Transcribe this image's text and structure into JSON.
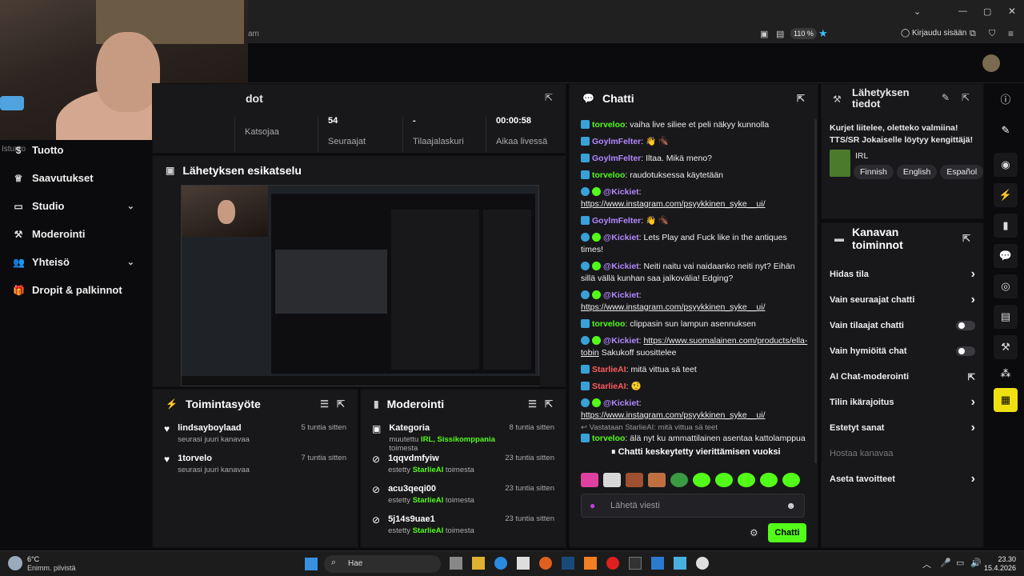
{
  "browser": {
    "zoom": "110 %",
    "login": "Kirjaudu sisään",
    "url_fragment": "am"
  },
  "sidebar": {
    "items": [
      {
        "label": "Tuotto",
        "icon": "dollar-icon"
      },
      {
        "label": "Saavutukset",
        "icon": "trophy-icon"
      },
      {
        "label": "Studio",
        "icon": "monitor-icon"
      },
      {
        "label": "Moderointi",
        "icon": "wrench-icon"
      },
      {
        "label": "Yhteisö",
        "icon": "users-icon"
      },
      {
        "label": "Dropit & palkinnot",
        "icon": "gift-icon"
      }
    ],
    "partial_label": "Istunto"
  },
  "stats": {
    "title_partial": "dot",
    "items": [
      {
        "value": "",
        "label": "Katsojaa"
      },
      {
        "value": "54",
        "label": "Seuraajat"
      },
      {
        "value": "-",
        "label": "Tilaajalaskuri"
      },
      {
        "value": "00:00:58",
        "label": "Aikaa livessä"
      }
    ]
  },
  "preview": {
    "title": "Lähetyksen esikatselu"
  },
  "activity": {
    "title": "Toimintasyöte",
    "rows": [
      {
        "name": "lindsayboylaad",
        "sub": "seurasi juuri kanavaa",
        "time": "5 tuntia sitten"
      },
      {
        "name": "1torvelo",
        "sub": "seurasi juuri kanavaa",
        "time": "7 tuntia sitten"
      }
    ]
  },
  "moderation": {
    "title": "Moderointi",
    "rows": [
      {
        "name": "Kategoria",
        "sub_pre": "muutettu",
        "sub_hl": "IRL, Sissikomppania",
        "sub_post": "toimesta",
        "time": "8 tuntia sitten"
      },
      {
        "name": "1qqvdmfyiw",
        "sub_pre": "estetty",
        "sub_hl": "StarlieAI",
        "sub_post": "toimesta",
        "time": "23 tuntia sitten"
      },
      {
        "name": "acu3qeqi00",
        "sub_pre": "estetty",
        "sub_hl": "StarlieAI",
        "sub_post": "toimesta",
        "time": "23 tuntia sitten"
      },
      {
        "name": "5j14s9uae1",
        "sub_pre": "estetty",
        "sub_hl": "StarlieAI",
        "sub_post": "toimesta",
        "time": "23 tuntia sitten"
      }
    ]
  },
  "chat": {
    "title": "Chatti",
    "messages": [
      {
        "user": "torveloo",
        "color": "#53fc18",
        "badge": "kick",
        "text": "vaiha live siliee et peli näkyy kunnolla"
      },
      {
        "user": "GoylmFelter",
        "color": "#b388ff",
        "badge": "kick",
        "text": "👋 🪳"
      },
      {
        "user": "GoylmFelter",
        "color": "#b388ff",
        "badge": "kick",
        "text": "Iltaa. Mikä meno?"
      },
      {
        "user": "torveloo",
        "color": "#53fc18",
        "badge": "kick",
        "text": "raudotuksessa käytetään"
      },
      {
        "user": "@Kickiet",
        "color": "#b388ff",
        "badge": "bot",
        "link": "https://www.instagram.com/psyykkinen_syke__ui/"
      },
      {
        "user": "GoylmFelter",
        "color": "#b388ff",
        "badge": "kick",
        "text": "👋 🪳"
      },
      {
        "user": "@Kickiet",
        "color": "#b388ff",
        "badge": "bot",
        "text": "Lets Play and Fuck like in the antiques times!"
      },
      {
        "user": "@Kickiet",
        "color": "#b388ff",
        "badge": "bot",
        "text": "Neiti naitu vai naidaanko neiti nyt? Eihän sillä vällä kunhan saa jalkovälia! Edging?"
      },
      {
        "user": "@Kickiet",
        "color": "#b388ff",
        "badge": "bot",
        "link": "https://www.instagram.com/psyykkinen_syke__ui/"
      },
      {
        "user": "torveloo",
        "color": "#53fc18",
        "badge": "kick",
        "text": "clippasin sun lampun asennuksen"
      },
      {
        "user": "@Kickiet",
        "color": "#b388ff",
        "badge": "bot",
        "link": "https://www.suomalainen.com/products/ella-tobin",
        "text": "Sakukoff suosittelee"
      },
      {
        "user": "StarlieAI",
        "color": "#ff5c5c",
        "badge": "kick",
        "text": "mitä vittua sä teet"
      },
      {
        "user": "StarlieAI",
        "color": "#ff5c5c",
        "badge": "kick",
        "text": "🤨"
      },
      {
        "user": "@Kickiet",
        "color": "#b388ff",
        "badge": "bot",
        "link": "https://www.instagram.com/psyykkinen_syke__ui/"
      }
    ],
    "reply_note": "Vastataan StarlieAI: mitä vittua sä teet",
    "last_msg": {
      "user": "torveloo",
      "text": "älä nyt ku ammattilainen asentaa kattolamppua"
    },
    "paused": "Chatti keskeytetty vierittämisen vuoksi",
    "placeholder": "Lähetä viesti",
    "send": "Chatti"
  },
  "info": {
    "title": "Lähetyksen tiedot",
    "stream_title": "Kurjet liitelee, oletteko valmiina! TTS/SR Jokaiselle löytyy kengittäjä!",
    "category": "IRL",
    "languages": [
      "Finnish",
      "English",
      "Español"
    ]
  },
  "actions": {
    "title": "Kanavan toiminnot",
    "rows": [
      {
        "label": "Hidas tila",
        "kind": "chevron"
      },
      {
        "label": "Vain seuraajat chatti",
        "kind": "chevron"
      },
      {
        "label": "Vain tilaajat chatti",
        "kind": "toggle"
      },
      {
        "label": "Vain hymiöitä chat",
        "kind": "toggle"
      },
      {
        "label": "AI Chat-moderointi",
        "kind": "external"
      },
      {
        "label": "Tilin ikärajoitus",
        "kind": "chevron"
      },
      {
        "label": "Estetyt sanat",
        "kind": "chevron"
      },
      {
        "label": "Hostaa kanavaa",
        "kind": "disabled"
      },
      {
        "label": "Aseta tavoitteet",
        "kind": "chevron"
      }
    ]
  },
  "taskbar": {
    "weather_temp": "6°C",
    "weather_desc": "Enimm. pilvistä",
    "search": "Hae",
    "time": "23.30",
    "date": "15.4.2026"
  }
}
